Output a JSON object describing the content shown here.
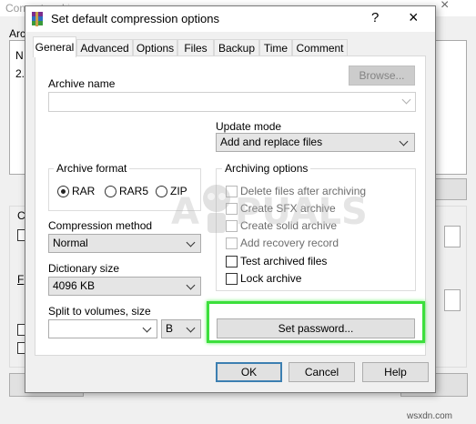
{
  "background_window": {
    "title": "Convert archives",
    "close_glyph": "×",
    "left_fragments": [
      "Arc",
      "N",
      "2.",
      "C",
      "F"
    ]
  },
  "dialog": {
    "title": "Set default compression options",
    "help_glyph": "?",
    "close_glyph": "×"
  },
  "tabs": [
    "General",
    "Advanced",
    "Options",
    "Files",
    "Backup",
    "Time",
    "Comment"
  ],
  "general": {
    "archive_name_label": "Archive name",
    "browse_label": "Browse...",
    "update_mode_label": "Update mode",
    "update_mode_value": "Add and replace files",
    "archive_format_label": "Archive format",
    "formats": [
      {
        "label": "RAR",
        "selected": true
      },
      {
        "label": "RAR5",
        "selected": false
      },
      {
        "label": "ZIP",
        "selected": false
      }
    ],
    "compression_method_label": "Compression method",
    "compression_method_value": "Normal",
    "dictionary_size_label": "Dictionary size",
    "dictionary_size_value": "4096 KB",
    "split_label": "Split to volumes, size",
    "split_unit_value": "B",
    "archiving_options_label": "Archiving options",
    "options": [
      {
        "label": "Delete files after archiving",
        "enabled": false,
        "checked": false
      },
      {
        "label": "Create SFX archive",
        "enabled": false,
        "checked": false
      },
      {
        "label": "Create solid archive",
        "enabled": false,
        "checked": false
      },
      {
        "label": "Add recovery record",
        "enabled": false,
        "checked": false
      },
      {
        "label": "Test archived files",
        "enabled": true,
        "checked": false
      },
      {
        "label": "Lock archive",
        "enabled": true,
        "checked": false
      }
    ],
    "set_password_label": "Set password..."
  },
  "buttons": {
    "ok": "OK",
    "cancel": "Cancel",
    "help": "Help"
  },
  "watermark": {
    "text_left": "A",
    "text_right": "PUALS"
  },
  "footer": "wsxdn.com",
  "colors": {
    "highlight": "#3cdf3c",
    "default_button_border": "#3c7fb1"
  }
}
